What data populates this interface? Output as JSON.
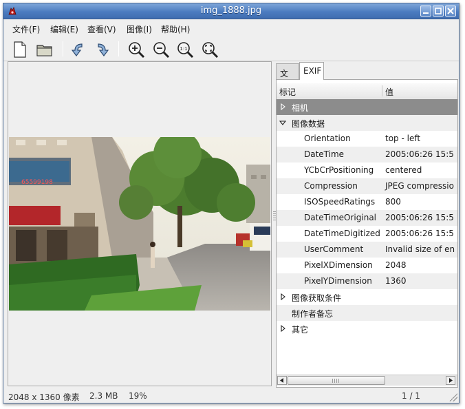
{
  "window": {
    "title": "img_1888.jpg"
  },
  "menu": [
    {
      "label": "文件(F)"
    },
    {
      "label": "编辑(E)"
    },
    {
      "label": "查看(V)"
    },
    {
      "label": "图像(I)"
    },
    {
      "label": "帮助(H)"
    }
  ],
  "toolbar": {
    "icons": [
      "new-document-icon",
      "open-folder-icon",
      "rotate-left-icon",
      "rotate-right-icon",
      "zoom-in-icon",
      "zoom-out-icon",
      "zoom-original-icon",
      "zoom-fit-icon"
    ]
  },
  "tabs": [
    {
      "label": "文件",
      "active": false
    },
    {
      "label": "EXIF",
      "active": true
    }
  ],
  "exif": {
    "col_tag": "标记",
    "col_value": "值",
    "rows": [
      {
        "tag": "相机",
        "value": "",
        "level": 0,
        "expander": "collapsed",
        "selected": true
      },
      {
        "tag": "图像数据",
        "value": "",
        "level": 0,
        "expander": "expanded"
      },
      {
        "tag": "Orientation",
        "value": "top - left",
        "level": 1
      },
      {
        "tag": "DateTime",
        "value": "2005:06:26 15:5",
        "level": 1
      },
      {
        "tag": "YCbCrPositioning",
        "value": "centered",
        "level": 1
      },
      {
        "tag": "Compression",
        "value": "JPEG compressio",
        "level": 1
      },
      {
        "tag": "ISOSpeedRatings",
        "value": "800",
        "level": 1
      },
      {
        "tag": "DateTimeOriginal",
        "value": "2005:06:26 15:5",
        "level": 1
      },
      {
        "tag": "DateTimeDigitized",
        "value": "2005:06:26 15:5",
        "level": 1
      },
      {
        "tag": "UserComment",
        "value": "Invalid size of en",
        "level": 1
      },
      {
        "tag": "PixelXDimension",
        "value": "2048",
        "level": 1
      },
      {
        "tag": "PixelYDimension",
        "value": "1360",
        "level": 1
      },
      {
        "tag": "图像获取条件",
        "value": "",
        "level": 0,
        "expander": "collapsed"
      },
      {
        "tag": "制作者备忘",
        "value": "",
        "level": 0,
        "expander": "none"
      },
      {
        "tag": "其它",
        "value": "",
        "level": 0,
        "expander": "collapsed"
      }
    ]
  },
  "status": {
    "dimensions": "2048 x 1360 像素",
    "size": "2.3 MB",
    "zoom": "19%",
    "page": "1 / 1"
  },
  "colors": {
    "titlebar": "#4c7cc0",
    "selected_row": "#8c8c8c"
  }
}
